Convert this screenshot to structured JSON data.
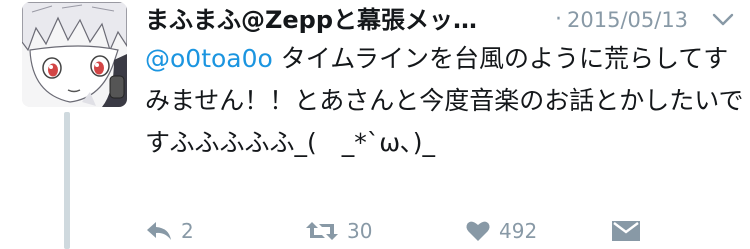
{
  "tweet": {
    "display_name": "まふまふ@Zeppと幕張メッ…",
    "separator": "·",
    "date": "2015/05/13",
    "mention": "@o0toa0o",
    "text": " タイムラインを台風のように荒らしてすみません！！とあさんと今度音楽のお話とかしたいですふふふふふ_(　_*`ω､)_"
  },
  "actions": {
    "reply_count": "2",
    "retweet_count": "30",
    "like_count": "492"
  },
  "icons": {
    "caret": "chevron-down-icon",
    "reply": "reply-icon",
    "retweet": "retweet-icon",
    "like": "heart-icon",
    "dm": "envelope-icon"
  },
  "colors": {
    "text": "#14171a",
    "muted": "#8899a6",
    "link": "#1b95e0"
  }
}
